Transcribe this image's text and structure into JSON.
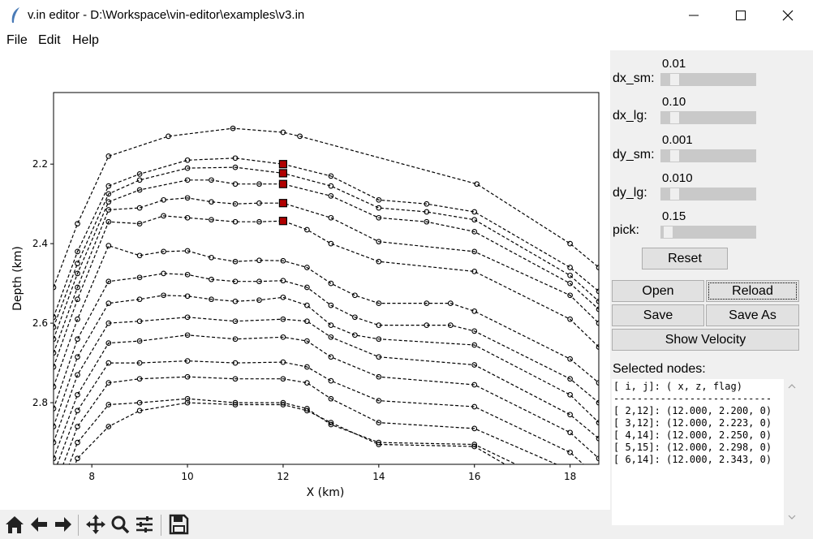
{
  "window": {
    "title": "v.in editor - D:\\Workspace\\vin-editor\\examples\\v3.in",
    "app_icon": "feather-icon"
  },
  "menu": {
    "file": "File",
    "edit": "Edit",
    "help": "Help"
  },
  "controls": {
    "dx_sm": {
      "label": "dx_sm:",
      "value": "0.01"
    },
    "dx_lg": {
      "label": "dx_lg:",
      "value": "0.10"
    },
    "dy_sm": {
      "label": "dy_sm:",
      "value": "0.001"
    },
    "dy_lg": {
      "label": "dy_lg:",
      "value": "0.010"
    },
    "pick": {
      "label": "pick:",
      "value": "0.15"
    },
    "reset": "Reset",
    "open": "Open",
    "reload": "Reload",
    "save": "Save",
    "save_as": "Save As",
    "show_velocity": "Show Velocity"
  },
  "selected": {
    "label": "Selected nodes:",
    "header": "[ i, j]: ( x, z, flag)",
    "divider": "---------------------------",
    "rows": [
      "[ 2,12]: (12.000, 2.200, 0)",
      "[ 3,12]: (12.000, 2.223, 0)",
      "[ 4,14]: (12.000, 2.250, 0)",
      "[ 5,15]: (12.000, 2.298, 0)",
      "[ 6,14]: (12.000, 2.343, 0)"
    ]
  },
  "toolbar": {
    "icons": [
      "home-icon",
      "back-icon",
      "forward-icon",
      "pan-icon",
      "zoom-icon",
      "configure-subplots-icon",
      "save-figure-icon"
    ]
  },
  "chart_data": {
    "type": "line",
    "xlabel": "X (km)",
    "ylabel": "Depth (km)",
    "xlim": [
      7.2,
      18.6
    ],
    "ylim": [
      2.955,
      2.02
    ],
    "y_inverted": true,
    "xticks": [
      "8",
      "10",
      "12",
      "14",
      "16",
      "18"
    ],
    "yticks": [
      "2.2",
      "2.4",
      "2.6",
      "2.8"
    ],
    "line_color": "#000000",
    "line_style": "dashed",
    "marker": "open-circle",
    "selected_marker_color": "#b00000",
    "series": [
      {
        "x": [
          7.2,
          7.7,
          8.35,
          9.6,
          10.95,
          12.0,
          12.35,
          16.05,
          18.0,
          18.6
        ],
        "y": [
          2.51,
          2.35,
          2.18,
          2.13,
          2.11,
          2.12,
          2.13,
          2.25,
          2.4,
          2.46
        ]
      },
      {
        "x": [
          7.2,
          7.7,
          8.35,
          9.0,
          10.0,
          11.0,
          12.0,
          13.0,
          14.0,
          15.0,
          16.0,
          18.0,
          18.6
        ],
        "y": [
          2.585,
          2.42,
          2.255,
          2.225,
          2.19,
          2.185,
          2.2,
          2.23,
          2.29,
          2.3,
          2.32,
          2.46,
          2.52
        ]
      },
      {
        "x": [
          7.2,
          7.7,
          8.35,
          9.0,
          10.0,
          11.0,
          12.0,
          13.0,
          14.0,
          15.0,
          16.0,
          18.0,
          18.6
        ],
        "y": [
          2.61,
          2.45,
          2.275,
          2.24,
          2.21,
          2.208,
          2.223,
          2.255,
          2.31,
          2.32,
          2.34,
          2.48,
          2.545
        ]
      },
      {
        "x": [
          7.2,
          7.7,
          8.35,
          9.0,
          10.0,
          10.5,
          11.0,
          11.5,
          12.0,
          13.0,
          14.0,
          15.0,
          16.0,
          18.0,
          18.6
        ],
        "y": [
          2.64,
          2.475,
          2.295,
          2.265,
          2.24,
          2.24,
          2.25,
          2.25,
          2.25,
          2.28,
          2.335,
          2.345,
          2.37,
          2.5,
          2.565
        ]
      },
      {
        "x": [
          7.2,
          7.7,
          8.35,
          9.0,
          9.5,
          10.0,
          10.5,
          11.0,
          11.5,
          12.0,
          13.0,
          14.0,
          16.0,
          18.0,
          18.6
        ],
        "y": [
          2.675,
          2.51,
          2.315,
          2.31,
          2.29,
          2.285,
          2.295,
          2.3,
          2.298,
          2.298,
          2.335,
          2.395,
          2.42,
          2.53,
          2.6
        ]
      },
      {
        "x": [
          7.2,
          7.7,
          8.35,
          9.0,
          9.5,
          10.0,
          10.5,
          11.0,
          11.5,
          12.0,
          12.5,
          13.0,
          14.0,
          16.0,
          18.0,
          18.6
        ],
        "y": [
          2.71,
          2.54,
          2.345,
          2.35,
          2.33,
          2.335,
          2.34,
          2.345,
          2.345,
          2.343,
          2.365,
          2.4,
          2.445,
          2.47,
          2.59,
          2.66
        ]
      },
      {
        "x": [
          7.2,
          7.7,
          8.35,
          9.0,
          9.5,
          10.0,
          10.5,
          11.0,
          11.5,
          12.0,
          12.5,
          13.0,
          13.5,
          14.0,
          15.0,
          15.5,
          16.0,
          18.0,
          18.6
        ],
        "y": [
          2.76,
          2.59,
          2.405,
          2.43,
          2.42,
          2.418,
          2.435,
          2.445,
          2.442,
          2.443,
          2.46,
          2.5,
          2.53,
          2.55,
          2.55,
          2.55,
          2.57,
          2.69,
          2.75
        ]
      },
      {
        "x": [
          7.2,
          7.7,
          8.35,
          9.0,
          9.5,
          10.0,
          10.5,
          11.0,
          11.5,
          12.0,
          12.5,
          13.0,
          13.5,
          14.0,
          15.0,
          15.5,
          16.0,
          18.0,
          18.6
        ],
        "y": [
          2.815,
          2.64,
          2.495,
          2.485,
          2.475,
          2.478,
          2.49,
          2.495,
          2.495,
          2.493,
          2.51,
          2.555,
          2.585,
          2.605,
          2.605,
          2.605,
          2.62,
          2.74,
          2.8
        ]
      },
      {
        "x": [
          7.2,
          7.7,
          8.35,
          9.0,
          9.5,
          10.0,
          10.5,
          11.0,
          11.5,
          12.0,
          12.5,
          13.0,
          13.5,
          14.0,
          16.0,
          18.0,
          18.6
        ],
        "y": [
          2.86,
          2.685,
          2.55,
          2.54,
          2.53,
          2.532,
          2.54,
          2.545,
          2.542,
          2.535,
          2.555,
          2.605,
          2.63,
          2.64,
          2.655,
          2.78,
          2.85
        ]
      },
      {
        "x": [
          7.2,
          7.7,
          8.35,
          9.0,
          10.0,
          11.0,
          12.0,
          12.5,
          13.0,
          14.0,
          16.0,
          18.0,
          18.6
        ],
        "y": [
          2.9,
          2.73,
          2.6,
          2.595,
          2.585,
          2.595,
          2.59,
          2.595,
          2.635,
          2.685,
          2.705,
          2.83,
          2.89
        ]
      },
      {
        "x": [
          7.2,
          7.7,
          8.35,
          9.0,
          10.0,
          11.0,
          12.0,
          12.5,
          13.0,
          14.0,
          16.0,
          18.0,
          18.6
        ],
        "y": [
          2.94,
          2.78,
          2.65,
          2.645,
          2.63,
          2.64,
          2.635,
          2.645,
          2.685,
          2.735,
          2.755,
          2.875,
          2.94
        ]
      },
      {
        "x": [
          7.2,
          7.7,
          8.35,
          9.0,
          10.0,
          11.0,
          12.0,
          12.5,
          13.0,
          14.0,
          16.0,
          18.0,
          18.6
        ],
        "y": [
          2.98,
          2.82,
          2.7,
          2.7,
          2.695,
          2.7,
          2.698,
          2.71,
          2.745,
          2.795,
          2.81,
          2.925,
          2.99
        ]
      },
      {
        "x": [
          7.2,
          7.7,
          8.35,
          9.0,
          10.0,
          11.0,
          12.0,
          12.5,
          13.0,
          14.0,
          16.0,
          18.0,
          18.6
        ],
        "y": [
          3.02,
          2.86,
          2.75,
          2.74,
          2.735,
          2.74,
          2.74,
          2.75,
          2.79,
          2.85,
          2.865,
          2.97,
          3.04
        ]
      },
      {
        "x": [
          7.2,
          7.7,
          8.35,
          9.0,
          10.0,
          11.0,
          12.0,
          12.5,
          13.0,
          14.0,
          16.0,
          18.0,
          18.6
        ],
        "y": [
          3.06,
          2.9,
          2.805,
          2.8,
          2.79,
          2.8,
          2.8,
          2.815,
          2.855,
          2.9,
          2.905,
          3.02,
          3.09
        ]
      },
      {
        "x": [
          7.2,
          7.7,
          8.35,
          9.0,
          10.0,
          11.0,
          12.0,
          12.5,
          13.0,
          14.0,
          16.0,
          18.0,
          18.6
        ],
        "y": [
          3.1,
          2.94,
          2.86,
          2.82,
          2.8,
          2.805,
          2.805,
          2.82,
          2.85,
          2.905,
          2.91,
          3.05,
          3.12
        ]
      }
    ],
    "selected_points": [
      {
        "x": 12.0,
        "y": 2.2
      },
      {
        "x": 12.0,
        "y": 2.223
      },
      {
        "x": 12.0,
        "y": 2.25
      },
      {
        "x": 12.0,
        "y": 2.298
      },
      {
        "x": 12.0,
        "y": 2.343
      }
    ]
  }
}
